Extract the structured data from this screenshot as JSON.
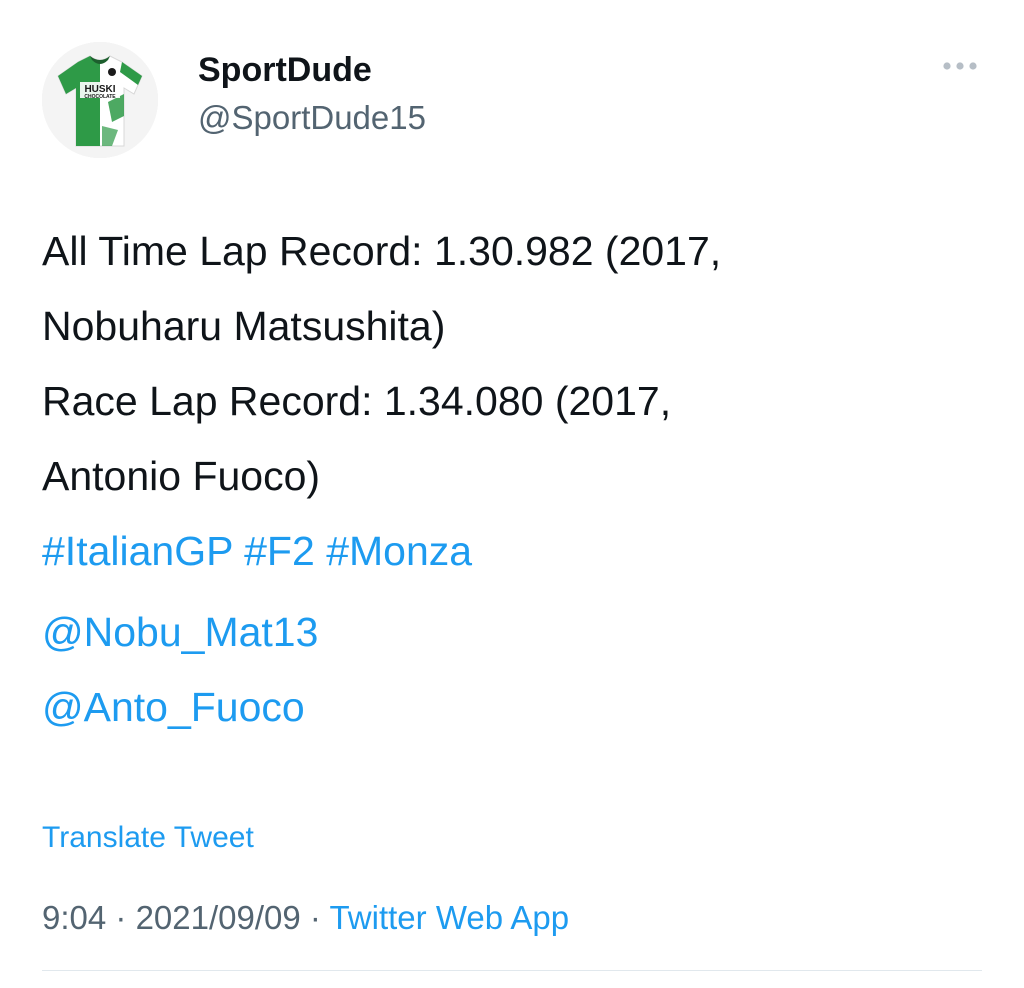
{
  "author": {
    "display_name": "SportDude",
    "handle": "@SportDude15",
    "avatar_icon": "football-shirt-avatar",
    "avatar_shirt_text_1": "HUSKI",
    "avatar_shirt_text_2": "CHOCOLATE"
  },
  "tweet": {
    "line1": "All Time Lap Record: 1.30.982 (2017,",
    "line2": "Nobuharu Matsushita)",
    "line3": "Race Lap Record: 1.34.080 (2017,",
    "line4": "Antonio Fuoco)",
    "hashtags": [
      "#ItalianGP",
      "#F2",
      "#Monza"
    ],
    "mentions": [
      "@Nobu_Mat13",
      "@Anto_Fuoco"
    ]
  },
  "translate_label": "Translate Tweet",
  "meta": {
    "time": "9:04",
    "separator": " · ",
    "date": "2021/09/09",
    "source": "Twitter Web App"
  },
  "colors": {
    "link": "#1d9bf0",
    "secondary": "#536471",
    "text": "#0f1419",
    "shirt_green": "#2e9a47"
  }
}
